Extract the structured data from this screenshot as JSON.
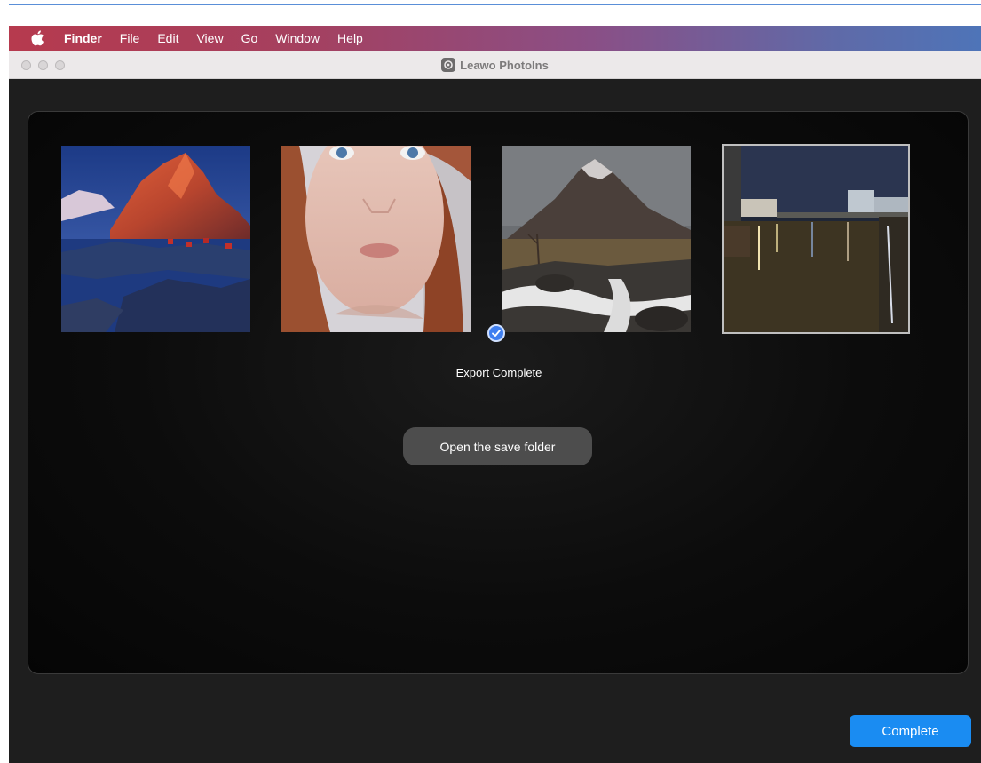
{
  "menubar": {
    "apple_icon": "apple-icon",
    "items": [
      "Finder",
      "File",
      "Edit",
      "View",
      "Go",
      "Window",
      "Help"
    ]
  },
  "window": {
    "title": "Leawo PhotoIns",
    "logo_icon": "leawo-logo-icon"
  },
  "gallery": {
    "images": [
      {
        "subject": "mountain-lake-landscape"
      },
      {
        "subject": "portrait-red-hair-woman"
      },
      {
        "subject": "mountain-waterfall"
      },
      {
        "subject": "night-river-city"
      }
    ],
    "check_icon": "checkmark-icon"
  },
  "export": {
    "status": "Export Complete",
    "open_folder_label": "Open the save folder"
  },
  "footer": {
    "complete_label": "Complete"
  },
  "colors": {
    "accent": "#1a8cf2",
    "check_badge": "#3f7ff0",
    "window_bg": "#1e1e1e"
  }
}
